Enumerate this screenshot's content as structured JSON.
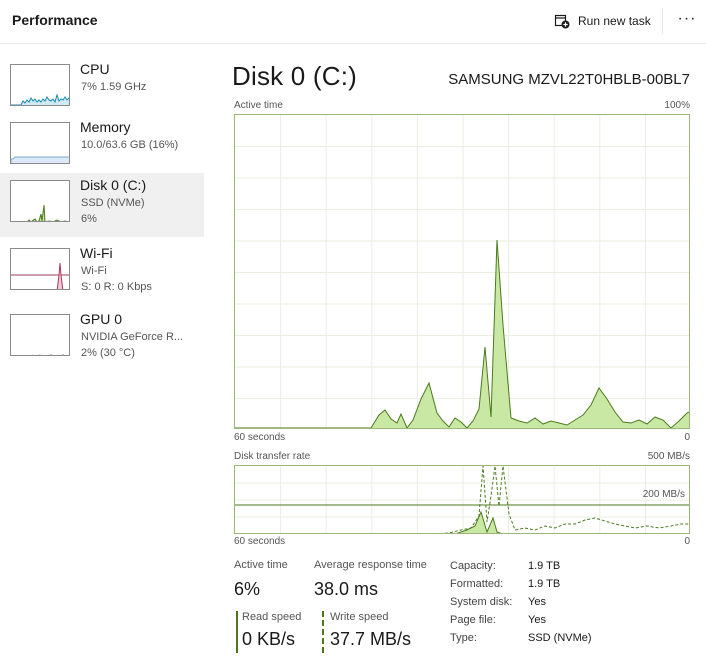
{
  "header": {
    "title": "Performance",
    "run_new_task": "Run new task",
    "more_label": "···"
  },
  "sidebar": {
    "items": [
      {
        "name": "CPU",
        "line1": "7%  1.59 GHz",
        "line2": ""
      },
      {
        "name": "Memory",
        "line1": "10.0/63.6 GB (16%)",
        "line2": ""
      },
      {
        "name": "Disk 0 (C:)",
        "line1": "SSD (NVMe)",
        "line2": "6%"
      },
      {
        "name": "Wi-Fi",
        "line1": "Wi-Fi",
        "line2": "S: 0 R: 0 Kbps"
      },
      {
        "name": "GPU 0",
        "line1": "NVIDIA GeForce R...",
        "line2": "2%  (30 °C)"
      }
    ]
  },
  "main": {
    "title": "Disk 0 (C:)",
    "model": "SAMSUNG MZVL22T0HBLB-00BL7",
    "active_time_label": "Active time",
    "active_time_max": "100%",
    "active_time_xleft": "60 seconds",
    "active_time_xright": "0",
    "transfer_label": "Disk transfer rate",
    "transfer_max": "500 MB/s",
    "transfer_mid": "200 MB/s",
    "transfer_xleft": "60 seconds",
    "transfer_xright": "0"
  },
  "stats": {
    "active_time_label": "Active time",
    "active_time_value": "6%",
    "avg_response_label": "Average response time",
    "avg_response_value": "38.0 ms",
    "read_speed_label": "Read speed",
    "read_speed_value": "0 KB/s",
    "write_speed_label": "Write speed",
    "write_speed_value": "37.7 MB/s"
  },
  "properties": [
    {
      "key": "Capacity:",
      "value": "1.9 TB"
    },
    {
      "key": "Formatted:",
      "value": "1.9 TB"
    },
    {
      "key": "System disk:",
      "value": "Yes"
    },
    {
      "key": "Page file:",
      "value": "Yes"
    },
    {
      "key": "Type:",
      "value": "SSD (NVMe)"
    }
  ],
  "colors": {
    "disk_line": "#4b7a1c",
    "disk_fill": "#c9e8a4",
    "grid": "#e9efe1",
    "cpu_line": "#1a8ab4",
    "memory_line": "#7aa7d6",
    "wifi_line": "#a23a5c",
    "gpu_line": "#6f6f6f"
  },
  "icons": {
    "run_task": "new-task-icon",
    "more": "more-options-icon"
  }
}
